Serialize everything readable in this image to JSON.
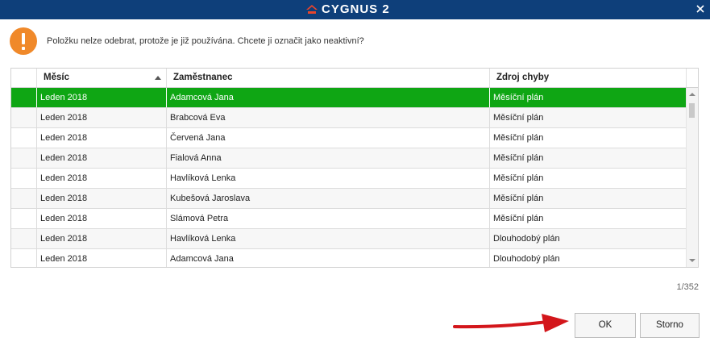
{
  "app": {
    "brand": "CYGNUS 2",
    "accent": "#0e3f7a",
    "logo_color": "#e8452c"
  },
  "dialog": {
    "icon": "warning-exclamation-icon",
    "message": "Položku nelze odebrat, protože je již používána. Chcete ji označit jako neaktivní?",
    "counter": "1/352",
    "ok_label": "OK",
    "cancel_label": "Storno"
  },
  "table": {
    "columns": [
      "Měsíc",
      "Zaměstnanec",
      "Zdroj chyby"
    ],
    "sort_column": "Měsíc",
    "sort_direction": "ascending",
    "selected_row": 0,
    "selection_color": "#0fa614",
    "rows": [
      {
        "mesic": "Leden 2018",
        "zamestnanec": "Adamcová Jana",
        "zdroj": "Měsíční plán"
      },
      {
        "mesic": "Leden 2018",
        "zamestnanec": "Brabcová Eva",
        "zdroj": "Měsíční plán"
      },
      {
        "mesic": "Leden 2018",
        "zamestnanec": "Červená Jana",
        "zdroj": "Měsíční plán"
      },
      {
        "mesic": "Leden 2018",
        "zamestnanec": "Fialová Anna",
        "zdroj": "Měsíční plán"
      },
      {
        "mesic": "Leden 2018",
        "zamestnanec": "Havlíková Lenka",
        "zdroj": "Měsíční plán"
      },
      {
        "mesic": "Leden 2018",
        "zamestnanec": "Kubešová Jaroslava",
        "zdroj": "Měsíční plán"
      },
      {
        "mesic": "Leden 2018",
        "zamestnanec": "Slámová Petra",
        "zdroj": "Měsíční plán"
      },
      {
        "mesic": "Leden 2018",
        "zamestnanec": "Havlíková Lenka",
        "zdroj": "Dlouhodobý plán"
      },
      {
        "mesic": "Leden 2018",
        "zamestnanec": "Adamcová Jana",
        "zdroj": "Dlouhodobý plán"
      }
    ]
  }
}
